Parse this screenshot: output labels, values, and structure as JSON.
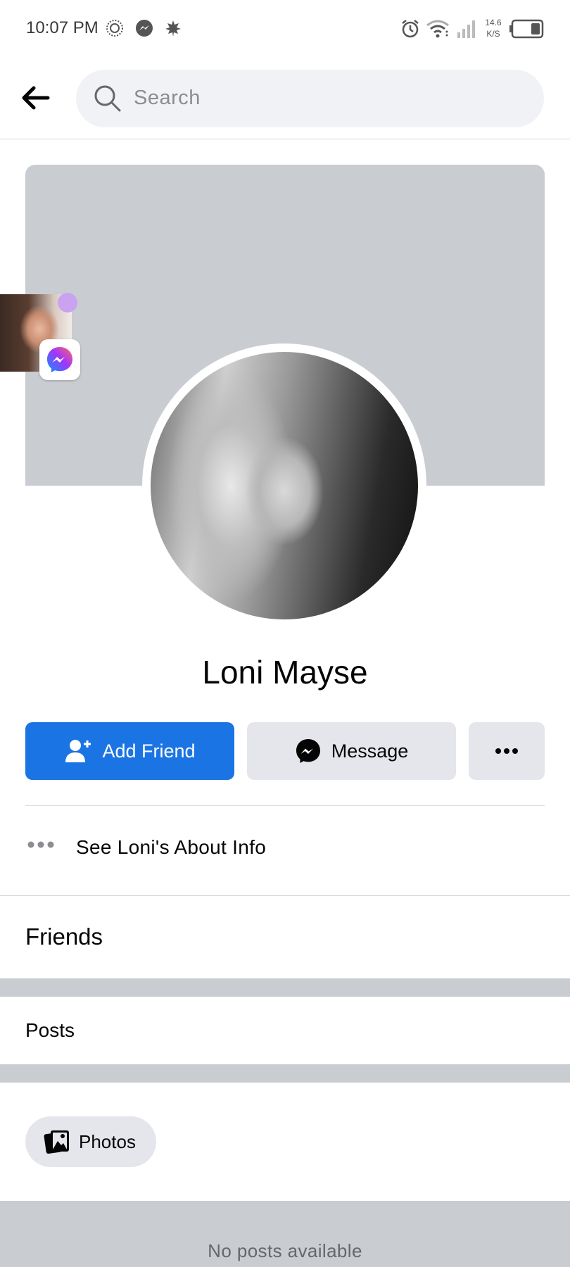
{
  "status_bar": {
    "time": "10:07 PM",
    "net_speed_value": "14.6",
    "net_speed_unit": "K/S",
    "icons": [
      "data-saver-icon",
      "messenger-icon",
      "leaf-icon",
      "alarm-icon",
      "wifi-icon",
      "signal-icon",
      "battery-icon"
    ]
  },
  "header": {
    "back_icon": "arrow-left-icon",
    "search": {
      "placeholder": "Search",
      "icon": "search-icon"
    }
  },
  "profile": {
    "name": "Loni Mayse",
    "actions": {
      "add_friend_label": "Add Friend",
      "message_label": "Message",
      "more_icon": "more-icon"
    },
    "about_label": "See Loni's About Info"
  },
  "sections": {
    "friends_title": "Friends",
    "posts_title": "Posts",
    "photos_label": "Photos",
    "no_posts": "No posts available"
  },
  "colors": {
    "primary": "#1b74e4",
    "button_gray": "#e4e6eb",
    "cover_gray": "#c9ccd1",
    "messenger_gradient": [
      "#0695ff",
      "#a334fa",
      "#ff6968"
    ]
  }
}
